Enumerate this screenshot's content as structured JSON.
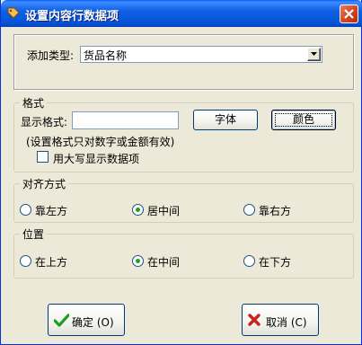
{
  "window": {
    "title": "设置内容行数据项",
    "close_label": "×"
  },
  "top": {
    "type_label": "添加类型:",
    "type_value": "货品名称"
  },
  "format": {
    "legend": "格式",
    "display_label": "显示格式:",
    "display_value": "",
    "font_button": "字体",
    "color_button": "颜色",
    "note": "(设置格式只对数字或金额有效)",
    "uppercase_label": "用大写显示数据项",
    "uppercase_checked": false
  },
  "align": {
    "legend": "对齐方式",
    "options": [
      "靠左方",
      "居中间",
      "靠右方"
    ],
    "selected": "居中间"
  },
  "position": {
    "legend": "位置",
    "options": [
      "在上方",
      "在中间",
      "在下方"
    ],
    "selected": "在中间"
  },
  "footer": {
    "ok_label": "确定 (O)",
    "cancel_label": "取消 (C)"
  },
  "colors": {
    "title_bar": "#0553D6",
    "dialog_bg": "#ECE9D8",
    "ok_icon": "#1E9E1E",
    "cancel_icon": "#C8241A",
    "radio_dot": "#21A121"
  },
  "icons": {
    "title": "tag-icon",
    "close": "close-icon",
    "dropdown": "chevron-down-icon",
    "ok": "checkmark-icon",
    "cancel": "x-icon"
  }
}
